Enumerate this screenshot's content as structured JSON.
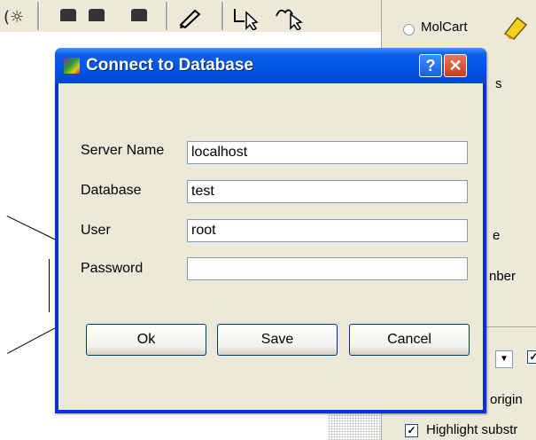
{
  "background": {
    "molcart_label": "MolCart",
    "partial_label_s": "s",
    "partial_label_e": "e",
    "partial_label_number": "nber",
    "partial_label_origin": "origin",
    "highlight_label": "Highlight substr"
  },
  "dialog": {
    "title": "Connect to Database",
    "help_glyph": "?",
    "close_glyph": "✕",
    "fields": [
      {
        "label": "Server Name",
        "value": "localhost"
      },
      {
        "label": "Database",
        "value": "test"
      },
      {
        "label": "User",
        "value": "root"
      },
      {
        "label": "Password",
        "value": ""
      }
    ],
    "buttons": {
      "ok": "Ok",
      "save": "Save",
      "cancel": "Cancel"
    }
  },
  "colors": {
    "titlebar": "#0054e3",
    "dialog_face": "#ece9d8",
    "close_button": "#c83d18"
  },
  "icons": [
    "toolbar-tool-icon",
    "block-icon",
    "pencil-icon",
    "select-arrow-icon",
    "lasso-select-icon",
    "eraser-icon",
    "app-icon",
    "help-icon",
    "close-icon",
    "checkbox-icon",
    "dropdown-arrow-icon"
  ]
}
